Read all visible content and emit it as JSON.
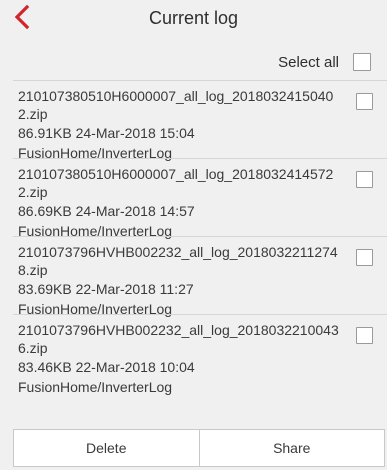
{
  "header": {
    "title": "Current log",
    "back_icon": "chevron-left-icon",
    "accent_color": "#d1242b"
  },
  "select_all": {
    "label": "Select all",
    "checked": false
  },
  "logs": [
    {
      "filename": "210107380510H6000007_all_log_20180324150402.zip",
      "size_date": "86.91KB 24-Mar-2018 15:04",
      "path": "FusionHome/InverterLog",
      "checked": false
    },
    {
      "filename": "210107380510H6000007_all_log_20180324145722.zip",
      "size_date": "86.69KB 24-Mar-2018 14:57",
      "path": "FusionHome/InverterLog",
      "checked": false
    },
    {
      "filename": "2101073796HVHB002232_all_log_20180322112748.zip",
      "size_date": "83.69KB 22-Mar-2018 11:27",
      "path": "FusionHome/InverterLog",
      "checked": false
    },
    {
      "filename": "2101073796HVHB002232_all_log_20180322100436.zip",
      "size_date": "83.46KB 22-Mar-2018 10:04",
      "path": "FusionHome/InverterLog",
      "checked": false
    }
  ],
  "actions": {
    "delete_label": "Delete",
    "share_label": "Share"
  }
}
